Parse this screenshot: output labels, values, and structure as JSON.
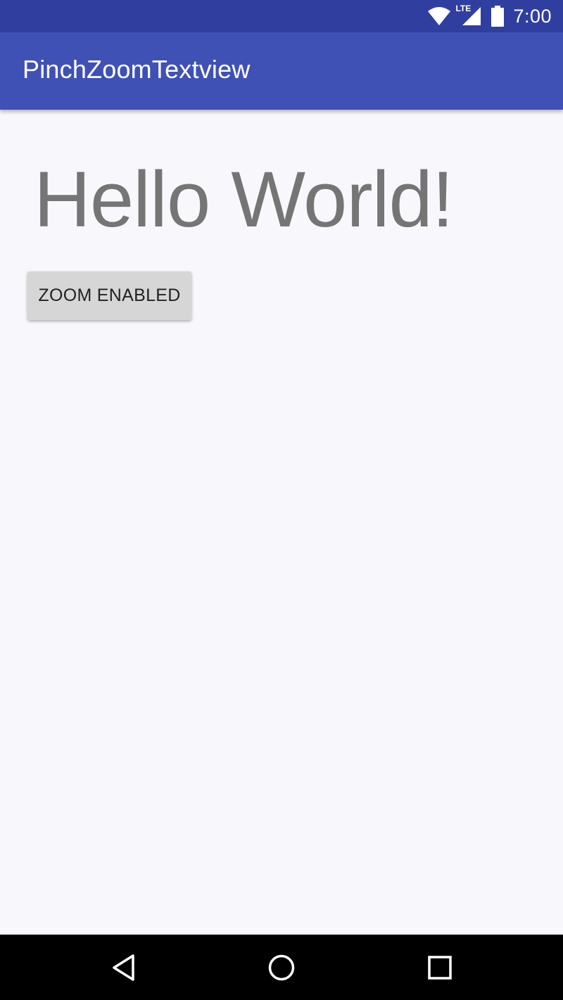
{
  "status_bar": {
    "time": "7:00",
    "network_label": "LTE",
    "icons": [
      "wifi-icon",
      "cell-signal-icon",
      "battery-icon"
    ],
    "color": "#303f9f"
  },
  "app_bar": {
    "title": "PinchZoomTextview",
    "color": "#3f51b5"
  },
  "main": {
    "hello_text": "Hello World!",
    "zoom_button_label": "ZOOM ENABLED"
  },
  "nav_bar": {
    "icons": [
      "back-icon",
      "home-icon",
      "recents-icon"
    ]
  }
}
